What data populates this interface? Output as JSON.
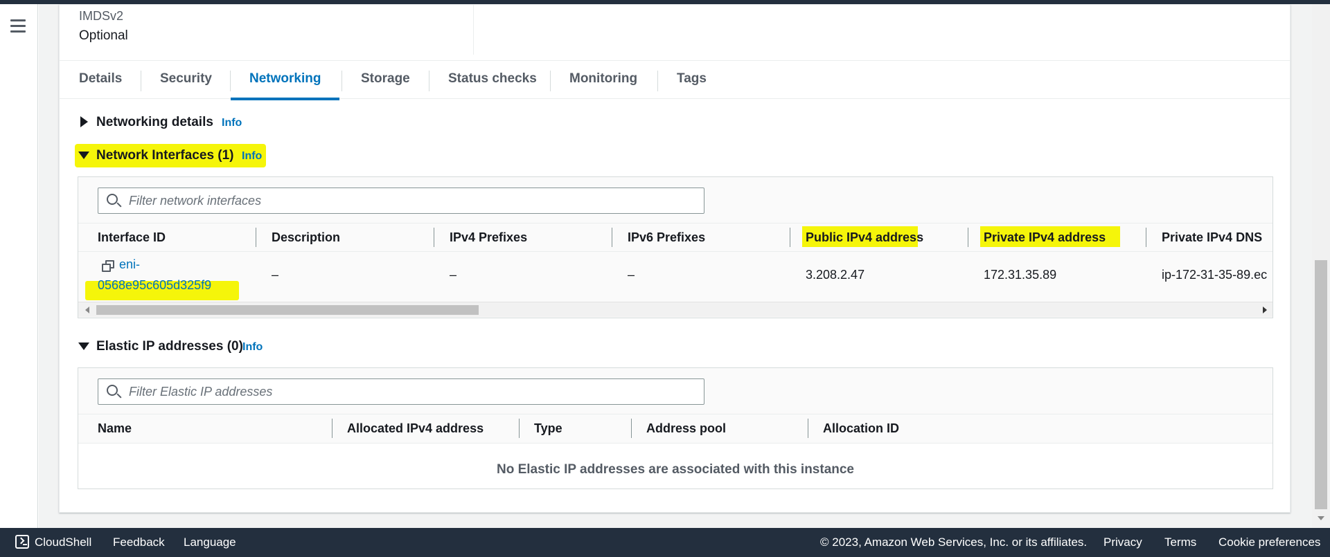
{
  "imds": {
    "label": "IMDSv2",
    "value": "Optional"
  },
  "tabs": [
    {
      "label": "Details"
    },
    {
      "label": "Security"
    },
    {
      "label": "Networking",
      "active": true
    },
    {
      "label": "Storage"
    },
    {
      "label": "Status checks"
    },
    {
      "label": "Monitoring"
    },
    {
      "label": "Tags"
    }
  ],
  "networking_details": {
    "title": "Networking details",
    "info": "Info",
    "expanded": false
  },
  "network_interfaces": {
    "title": "Network Interfaces (1)",
    "info": "Info",
    "filter_placeholder": "Filter network interfaces",
    "columns": [
      "Interface ID",
      "Description",
      "IPv4 Prefixes",
      "IPv6 Prefixes",
      "Public IPv4 address",
      "Private IPv4 address",
      "Private IPv4 DNS"
    ],
    "rows": [
      {
        "interface_id_line1": "eni-",
        "interface_id_line2": "0568e95c605d325f9",
        "description": "–",
        "ipv4_prefixes": "–",
        "ipv6_prefixes": "–",
        "public_ipv4": "3.208.2.47",
        "private_ipv4": "172.31.35.89",
        "private_dns": "ip-172-31-35-89.ec"
      }
    ]
  },
  "elastic_ips": {
    "title": "Elastic IP addresses (0)",
    "info": "Info",
    "filter_placeholder": "Filter Elastic IP addresses",
    "columns": [
      "Name",
      "Allocated IPv4 address",
      "Type",
      "Address pool",
      "Allocation ID"
    ],
    "empty_message": "No Elastic IP addresses are associated with this instance"
  },
  "footer": {
    "cloudshell": "CloudShell",
    "feedback": "Feedback",
    "language": "Language",
    "copyright": "© 2023, Amazon Web Services, Inc. or its affiliates.",
    "privacy": "Privacy",
    "terms": "Terms",
    "cookies": "Cookie preferences"
  },
  "colors": {
    "accent": "#0073bb",
    "highlight": "#f5f50a",
    "footer_bg": "#232f3e"
  }
}
